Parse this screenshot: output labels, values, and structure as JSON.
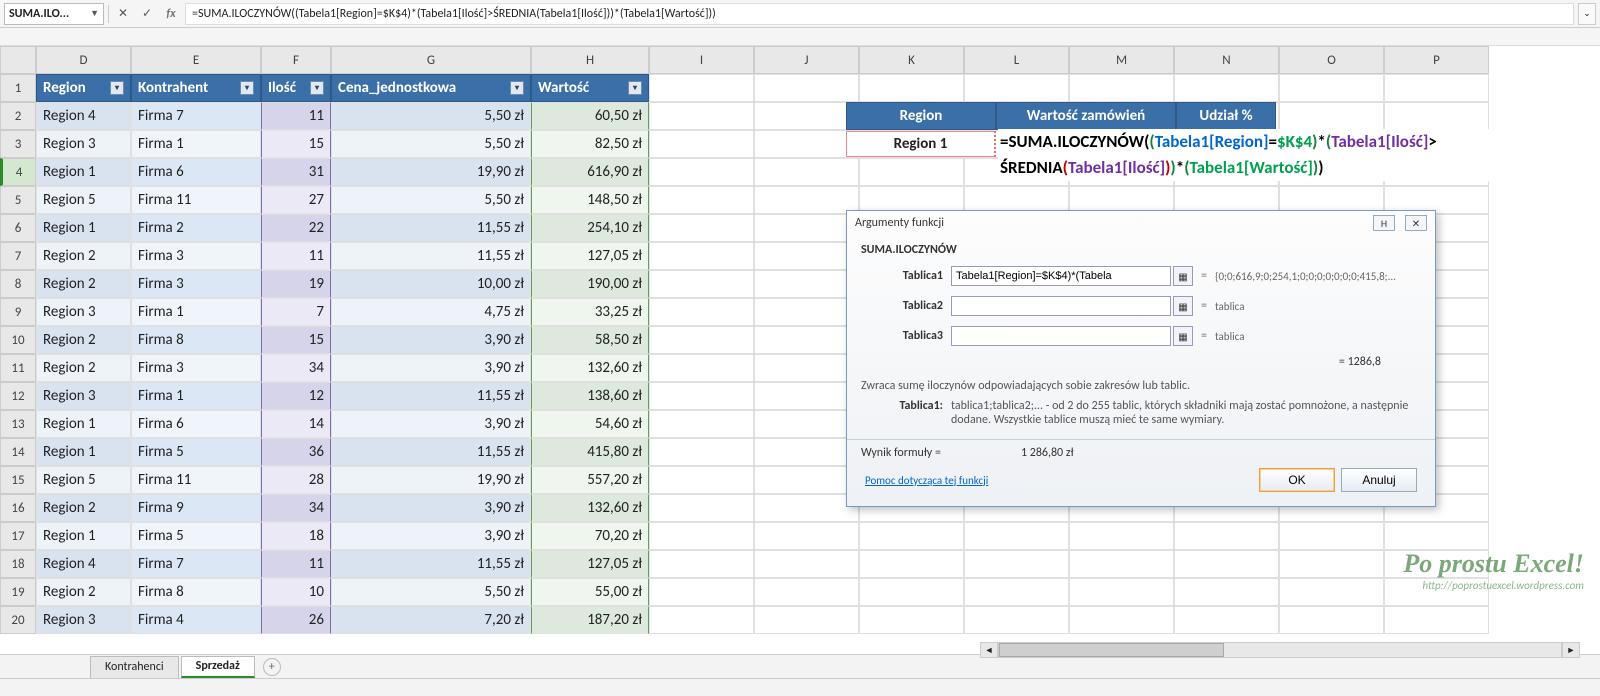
{
  "formula_bar": {
    "name_box": "SUMA.ILO...",
    "formula": "=SUMA.ILOCZYNÓW((Tabela1[Region]=$K$4)*(Tabela1[Ilość]>ŚREDNIA(Tabela1[Ilość]))*(Tabela1[Wartość]))"
  },
  "columns": [
    "D",
    "E",
    "F",
    "G",
    "H",
    "I",
    "J",
    "K",
    "L",
    "M",
    "N",
    "O",
    "P"
  ],
  "rows_visible": [
    1,
    2,
    3,
    4,
    5,
    6,
    7,
    8,
    9,
    10,
    11,
    12,
    13,
    14,
    15,
    16,
    17,
    18,
    19,
    20
  ],
  "selected_row": 4,
  "table": {
    "headers": [
      "Region",
      "Kontrahent",
      "Ilość",
      "Cena_jednostkowa",
      "Wartość"
    ],
    "rows": [
      {
        "r": "Region 4",
        "k": "Firma 7",
        "i": "11",
        "c": "5,50 zł",
        "w": "60,50 zł"
      },
      {
        "r": "Region 3",
        "k": "Firma 1",
        "i": "15",
        "c": "5,50 zł",
        "w": "82,50 zł"
      },
      {
        "r": "Region 1",
        "k": "Firma 6",
        "i": "31",
        "c": "19,90 zł",
        "w": "616,90 zł"
      },
      {
        "r": "Region 5",
        "k": "Firma 11",
        "i": "27",
        "c": "5,50 zł",
        "w": "148,50 zł"
      },
      {
        "r": "Region 1",
        "k": "Firma 2",
        "i": "22",
        "c": "11,55 zł",
        "w": "254,10 zł"
      },
      {
        "r": "Region 2",
        "k": "Firma 3",
        "i": "11",
        "c": "11,55 zł",
        "w": "127,05 zł"
      },
      {
        "r": "Region 2",
        "k": "Firma 3",
        "i": "19",
        "c": "10,00 zł",
        "w": "190,00 zł"
      },
      {
        "r": "Region 3",
        "k": "Firma 1",
        "i": "7",
        "c": "4,75 zł",
        "w": "33,25 zł"
      },
      {
        "r": "Region 2",
        "k": "Firma 8",
        "i": "15",
        "c": "3,90 zł",
        "w": "58,50 zł"
      },
      {
        "r": "Region 2",
        "k": "Firma 3",
        "i": "34",
        "c": "3,90 zł",
        "w": "132,60 zł"
      },
      {
        "r": "Region 3",
        "k": "Firma 1",
        "i": "12",
        "c": "11,55 zł",
        "w": "138,60 zł"
      },
      {
        "r": "Region 1",
        "k": "Firma 6",
        "i": "14",
        "c": "3,90 zł",
        "w": "54,60 zł"
      },
      {
        "r": "Region 1",
        "k": "Firma 5",
        "i": "36",
        "c": "11,55 zł",
        "w": "415,80 zł"
      },
      {
        "r": "Region 5",
        "k": "Firma 11",
        "i": "28",
        "c": "19,90 zł",
        "w": "557,20 zł"
      },
      {
        "r": "Region 2",
        "k": "Firma 9",
        "i": "34",
        "c": "3,90 zł",
        "w": "132,60 zł"
      },
      {
        "r": "Region 1",
        "k": "Firma 5",
        "i": "18",
        "c": "3,90 zł",
        "w": "70,20 zł"
      },
      {
        "r": "Region 4",
        "k": "Firma 7",
        "i": "11",
        "c": "11,55 zł",
        "w": "127,05 zł"
      },
      {
        "r": "Region 2",
        "k": "Firma 8",
        "i": "10",
        "c": "5,50 zł",
        "w": "55,00 zł"
      },
      {
        "r": "Region 3",
        "k": "Firma 4",
        "i": "26",
        "c": "7,20 zł",
        "w": "187,20 zł"
      }
    ]
  },
  "side_header": {
    "c1": "Region",
    "c2": "Wartość zamówień",
    "c3": "Udział %"
  },
  "region_cell": "Region 1",
  "overlay_formula": {
    "prefix_eq": "=",
    "fn": "SUMA.ILOCZYNÓW",
    "open": "(",
    "p1o": "(",
    "r1": "Tabela1[Region]",
    "p1c": "=",
    "ref": "$K$4",
    "p1cc": ")",
    "star1": "*",
    "p2o": "(",
    "r2": "Tabela1[Ilość]",
    "gt": ">",
    "fn2": "ŚREDNIA",
    "p3o": "(",
    "r3": "Tabela1[Ilość]",
    "p3c": ")",
    "p2c": ")",
    "star2": "*",
    "p4o": "(",
    "r4": "Tabela1[Wartość]",
    "p4c": ")",
    "close": ")"
  },
  "dialog": {
    "title": "Argumenty funkcji",
    "fn_name": "SUMA.ILOCZYNÓW",
    "rows": [
      {
        "label": "Tablica1",
        "value": "Tabela1[Region]=$K$4)*(Tabela",
        "out": "{0;0;616,9;0;254,1;0;0;0;0;0;0;0;415,8;..."
      },
      {
        "label": "Tablica2",
        "value": "",
        "out": "tablica"
      },
      {
        "label": "Tablica3",
        "value": "",
        "out": "tablica"
      }
    ],
    "result_eq": "=  1286,8",
    "desc": "Zwraca sumę iloczynów odpowiadających sobie zakresów lub tablic.",
    "param_name": "Tablica1:",
    "param_desc": "tablica1;tablica2;... - od 2 do 255 tablic, których składniki mają zostać pomnożone, a następnie dodane. Wszystkie tablice muszą mieć te same wymiary.",
    "result_label": "Wynik formuły =",
    "result_value": "1 286,80 zł",
    "help": "Pomoc dotycząca tej funkcji",
    "ok": "OK",
    "cancel": "Anuluj"
  },
  "tabs": {
    "t1": "Kontrahenci",
    "t2": "Sprzedaż"
  },
  "watermark": {
    "t1": "Po prostu Excel!",
    "t2": "http://poprostuexcel.wordpress.com"
  }
}
